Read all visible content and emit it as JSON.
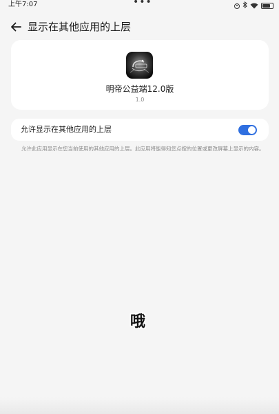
{
  "status_bar": {
    "time": "上午7:07",
    "dots": "•••",
    "icons": [
      "record-icon",
      "bluetooth-icon",
      "wifi-icon",
      "battery-icon"
    ]
  },
  "header": {
    "back_icon": "arrow-left-icon",
    "title": "显示在其他应用的上层"
  },
  "app_card": {
    "name": "明帝公益端12.0版",
    "version": "1.0"
  },
  "permission": {
    "label": "允许显示在其他应用的上层",
    "enabled": true,
    "toggle_color": "#2f6fe0"
  },
  "description": "允许此应用显示在您当前使用的其他应用的上层。此应用将能得知您点按的位置或更改屏幕上显示的内容。",
  "overlay_text": "哦"
}
